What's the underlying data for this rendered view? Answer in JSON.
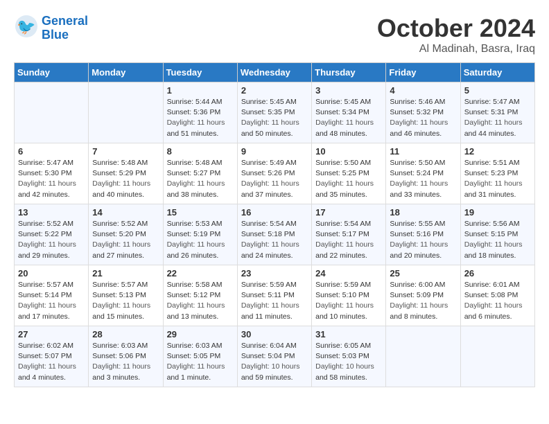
{
  "header": {
    "logo_general": "General",
    "logo_blue": "Blue",
    "month": "October 2024",
    "location": "Al Madinah, Basra, Iraq"
  },
  "days_of_week": [
    "Sunday",
    "Monday",
    "Tuesday",
    "Wednesday",
    "Thursday",
    "Friday",
    "Saturday"
  ],
  "weeks": [
    [
      {
        "day": "",
        "content": ""
      },
      {
        "day": "",
        "content": ""
      },
      {
        "day": "1",
        "content": "Sunrise: 5:44 AM\nSunset: 5:36 PM\nDaylight: 11 hours\nand 51 minutes."
      },
      {
        "day": "2",
        "content": "Sunrise: 5:45 AM\nSunset: 5:35 PM\nDaylight: 11 hours\nand 50 minutes."
      },
      {
        "day": "3",
        "content": "Sunrise: 5:45 AM\nSunset: 5:34 PM\nDaylight: 11 hours\nand 48 minutes."
      },
      {
        "day": "4",
        "content": "Sunrise: 5:46 AM\nSunset: 5:32 PM\nDaylight: 11 hours\nand 46 minutes."
      },
      {
        "day": "5",
        "content": "Sunrise: 5:47 AM\nSunset: 5:31 PM\nDaylight: 11 hours\nand 44 minutes."
      }
    ],
    [
      {
        "day": "6",
        "content": "Sunrise: 5:47 AM\nSunset: 5:30 PM\nDaylight: 11 hours\nand 42 minutes."
      },
      {
        "day": "7",
        "content": "Sunrise: 5:48 AM\nSunset: 5:29 PM\nDaylight: 11 hours\nand 40 minutes."
      },
      {
        "day": "8",
        "content": "Sunrise: 5:48 AM\nSunset: 5:27 PM\nDaylight: 11 hours\nand 38 minutes."
      },
      {
        "day": "9",
        "content": "Sunrise: 5:49 AM\nSunset: 5:26 PM\nDaylight: 11 hours\nand 37 minutes."
      },
      {
        "day": "10",
        "content": "Sunrise: 5:50 AM\nSunset: 5:25 PM\nDaylight: 11 hours\nand 35 minutes."
      },
      {
        "day": "11",
        "content": "Sunrise: 5:50 AM\nSunset: 5:24 PM\nDaylight: 11 hours\nand 33 minutes."
      },
      {
        "day": "12",
        "content": "Sunrise: 5:51 AM\nSunset: 5:23 PM\nDaylight: 11 hours\nand 31 minutes."
      }
    ],
    [
      {
        "day": "13",
        "content": "Sunrise: 5:52 AM\nSunset: 5:22 PM\nDaylight: 11 hours\nand 29 minutes."
      },
      {
        "day": "14",
        "content": "Sunrise: 5:52 AM\nSunset: 5:20 PM\nDaylight: 11 hours\nand 27 minutes."
      },
      {
        "day": "15",
        "content": "Sunrise: 5:53 AM\nSunset: 5:19 PM\nDaylight: 11 hours\nand 26 minutes."
      },
      {
        "day": "16",
        "content": "Sunrise: 5:54 AM\nSunset: 5:18 PM\nDaylight: 11 hours\nand 24 minutes."
      },
      {
        "day": "17",
        "content": "Sunrise: 5:54 AM\nSunset: 5:17 PM\nDaylight: 11 hours\nand 22 minutes."
      },
      {
        "day": "18",
        "content": "Sunrise: 5:55 AM\nSunset: 5:16 PM\nDaylight: 11 hours\nand 20 minutes."
      },
      {
        "day": "19",
        "content": "Sunrise: 5:56 AM\nSunset: 5:15 PM\nDaylight: 11 hours\nand 18 minutes."
      }
    ],
    [
      {
        "day": "20",
        "content": "Sunrise: 5:57 AM\nSunset: 5:14 PM\nDaylight: 11 hours\nand 17 minutes."
      },
      {
        "day": "21",
        "content": "Sunrise: 5:57 AM\nSunset: 5:13 PM\nDaylight: 11 hours\nand 15 minutes."
      },
      {
        "day": "22",
        "content": "Sunrise: 5:58 AM\nSunset: 5:12 PM\nDaylight: 11 hours\nand 13 minutes."
      },
      {
        "day": "23",
        "content": "Sunrise: 5:59 AM\nSunset: 5:11 PM\nDaylight: 11 hours\nand 11 minutes."
      },
      {
        "day": "24",
        "content": "Sunrise: 5:59 AM\nSunset: 5:10 PM\nDaylight: 11 hours\nand 10 minutes."
      },
      {
        "day": "25",
        "content": "Sunrise: 6:00 AM\nSunset: 5:09 PM\nDaylight: 11 hours\nand 8 minutes."
      },
      {
        "day": "26",
        "content": "Sunrise: 6:01 AM\nSunset: 5:08 PM\nDaylight: 11 hours\nand 6 minutes."
      }
    ],
    [
      {
        "day": "27",
        "content": "Sunrise: 6:02 AM\nSunset: 5:07 PM\nDaylight: 11 hours\nand 4 minutes."
      },
      {
        "day": "28",
        "content": "Sunrise: 6:03 AM\nSunset: 5:06 PM\nDaylight: 11 hours\nand 3 minutes."
      },
      {
        "day": "29",
        "content": "Sunrise: 6:03 AM\nSunset: 5:05 PM\nDaylight: 11 hours\nand 1 minute."
      },
      {
        "day": "30",
        "content": "Sunrise: 6:04 AM\nSunset: 5:04 PM\nDaylight: 10 hours\nand 59 minutes."
      },
      {
        "day": "31",
        "content": "Sunrise: 6:05 AM\nSunset: 5:03 PM\nDaylight: 10 hours\nand 58 minutes."
      },
      {
        "day": "",
        "content": ""
      },
      {
        "day": "",
        "content": ""
      }
    ]
  ]
}
